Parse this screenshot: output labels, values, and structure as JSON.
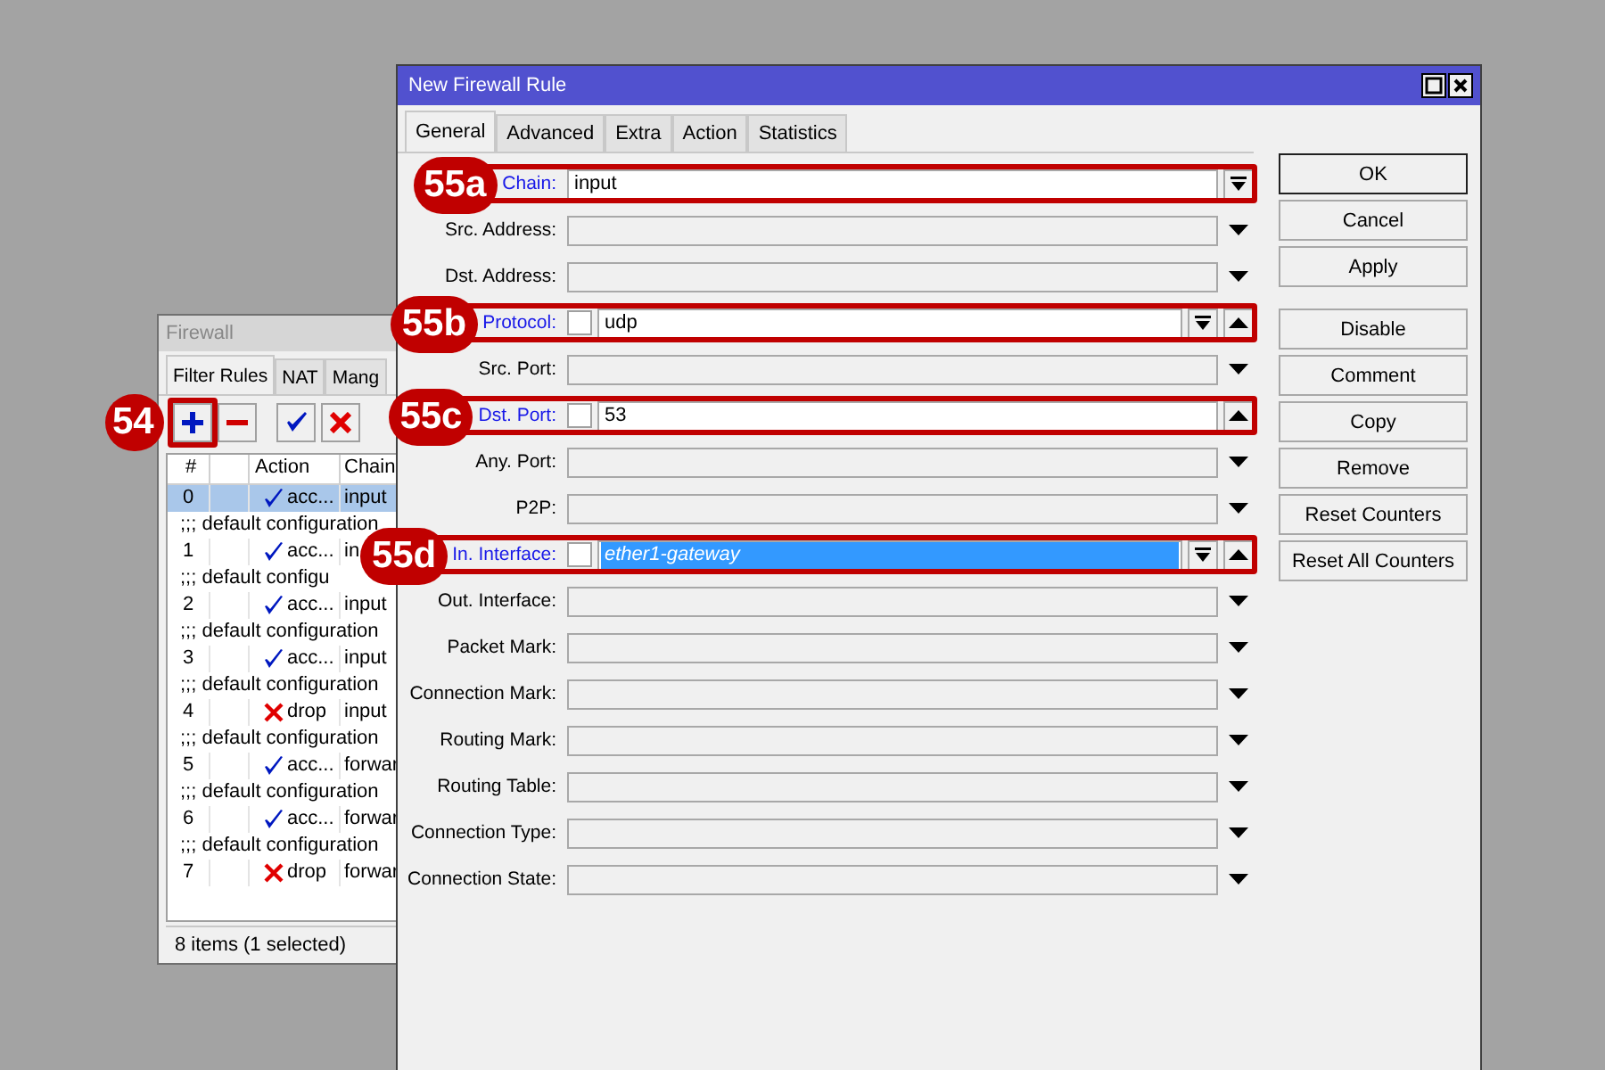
{
  "firewall_window": {
    "title": "Firewall",
    "tabs": [
      {
        "label": "Filter Rules",
        "selected": true
      },
      {
        "label": "NAT",
        "selected": false
      },
      {
        "label": "Mang",
        "selected": false
      }
    ],
    "add_callout": "54",
    "table": {
      "columns": [
        "#",
        "",
        "Action",
        "Chain"
      ],
      "rows": [
        {
          "kind": "rule",
          "number": "0",
          "action": {
            "kind": "accept",
            "label": "acc..."
          },
          "chain": "input",
          "selected": true
        },
        {
          "kind": "comment",
          "text": ";;; default configuration"
        },
        {
          "kind": "rule",
          "number": "1",
          "action": {
            "kind": "accept",
            "label": "acc..."
          },
          "chain": "in",
          "selected": false
        },
        {
          "kind": "comment",
          "text": ";;; default configu"
        },
        {
          "kind": "rule",
          "number": "2",
          "action": {
            "kind": "accept",
            "label": "acc..."
          },
          "chain": "input",
          "selected": false
        },
        {
          "kind": "comment",
          "text": ";;; default configuration"
        },
        {
          "kind": "rule",
          "number": "3",
          "action": {
            "kind": "accept",
            "label": "acc..."
          },
          "chain": "input",
          "selected": false
        },
        {
          "kind": "comment",
          "text": ";;; default configuration"
        },
        {
          "kind": "rule",
          "number": "4",
          "action": {
            "kind": "drop",
            "label": "drop"
          },
          "chain": "input",
          "selected": false
        },
        {
          "kind": "comment",
          "text": ";;; default configuration"
        },
        {
          "kind": "rule",
          "number": "5",
          "action": {
            "kind": "accept",
            "label": "acc..."
          },
          "chain": "forwar",
          "selected": false
        },
        {
          "kind": "comment",
          "text": ";;; default configuration"
        },
        {
          "kind": "rule",
          "number": "6",
          "action": {
            "kind": "accept",
            "label": "acc..."
          },
          "chain": "forwar",
          "selected": false
        },
        {
          "kind": "comment",
          "text": ";;; default configuration"
        },
        {
          "kind": "rule",
          "number": "7",
          "action": {
            "kind": "drop",
            "label": "drop"
          },
          "chain": "forwar",
          "selected": false
        }
      ]
    },
    "status": "8 items (1 selected)"
  },
  "dialog": {
    "title": "New Firewall Rule",
    "tabs": [
      {
        "label": "General",
        "selected": true
      },
      {
        "label": "Advanced",
        "selected": false
      },
      {
        "label": "Extra",
        "selected": false
      },
      {
        "label": "Action",
        "selected": false
      },
      {
        "label": "Statistics",
        "selected": false
      }
    ],
    "groups": [
      [
        {
          "label": "Chain:",
          "highlighted": true,
          "value": "input",
          "buttons": [
            {
              "kind": "menu"
            }
          ],
          "callout": "55a"
        },
        {
          "label": "Src. Address:",
          "highlighted": false,
          "buttons": [
            {
              "kind": "expand"
            }
          ]
        },
        {
          "label": "Dst. Address:",
          "highlighted": false,
          "buttons": [
            {
              "kind": "expand"
            }
          ]
        },
        {
          "label": "Protocol:",
          "highlighted": true,
          "not_box": false,
          "value": "udp",
          "buttons": [
            {
              "kind": "menu"
            },
            {
              "kind": "remove"
            }
          ],
          "callout": "55b"
        },
        {
          "label": "Src. Port:",
          "highlighted": false,
          "buttons": [
            {
              "kind": "expand"
            }
          ]
        },
        {
          "label": "Dst. Port:",
          "highlighted": true,
          "not_box": false,
          "value": "53",
          "buttons": [
            {
              "kind": "remove"
            }
          ],
          "callout": "55c"
        },
        {
          "label": "Any. Port:",
          "highlighted": false,
          "buttons": [
            {
              "kind": "expand"
            }
          ]
        },
        {
          "label": "P2P:",
          "highlighted": false,
          "buttons": [
            {
              "kind": "expand"
            }
          ]
        },
        {
          "label": "In. Interface:",
          "highlighted": true,
          "not_box": false,
          "value": "ether1-gateway",
          "value_selected": true,
          "buttons": [
            {
              "kind": "menu"
            },
            {
              "kind": "remove"
            }
          ],
          "callout": "55d"
        },
        {
          "label": "Out. Interface:",
          "highlighted": false,
          "buttons": [
            {
              "kind": "expand"
            }
          ]
        }
      ],
      [
        {
          "label": "Packet Mark:",
          "highlighted": false,
          "buttons": [
            {
              "kind": "expand"
            }
          ]
        },
        {
          "label": "Connection Mark:",
          "highlighted": false,
          "buttons": [
            {
              "kind": "expand"
            }
          ]
        },
        {
          "label": "Routing Mark:",
          "highlighted": false,
          "buttons": [
            {
              "kind": "expand"
            }
          ]
        },
        {
          "label": "Routing Table:",
          "highlighted": false,
          "buttons": [
            {
              "kind": "expand"
            }
          ]
        }
      ],
      [
        {
          "label": "Connection Type:",
          "highlighted": false,
          "buttons": [
            {
              "kind": "expand"
            }
          ]
        },
        {
          "label": "Connection State:",
          "highlighted": false,
          "buttons": [
            {
              "kind": "expand"
            }
          ]
        }
      ]
    ],
    "buttons": [
      {
        "label": "OK",
        "default": true
      },
      {
        "label": "Cancel",
        "default": false
      },
      {
        "label": "Apply",
        "default": false
      }
    ],
    "more_buttons": [
      {
        "label": "Disable"
      },
      {
        "label": "Comment"
      },
      {
        "label": "Copy"
      },
      {
        "label": "Remove"
      },
      {
        "label": "Reset Counters"
      },
      {
        "label": "Reset All Counters"
      }
    ]
  }
}
